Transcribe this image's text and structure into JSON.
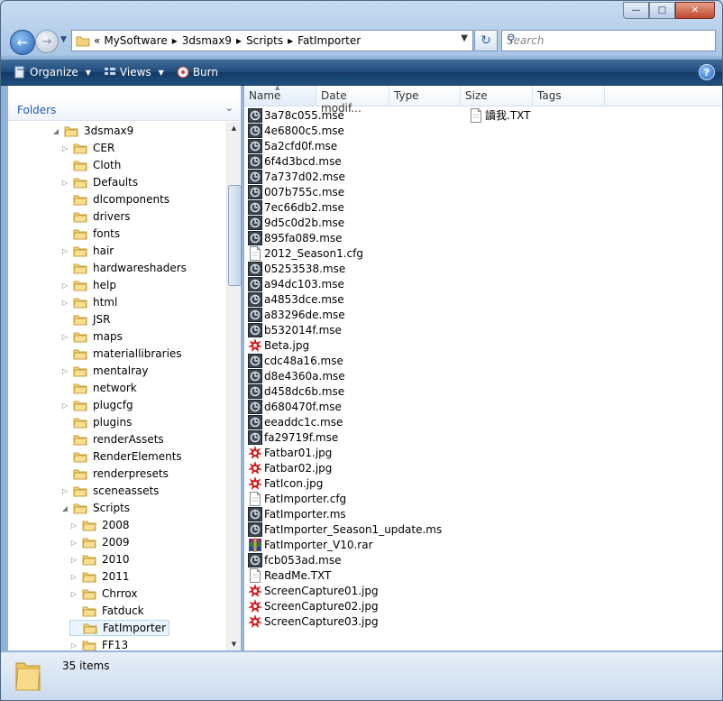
{
  "window": {
    "caption_buttons": [
      "minimize",
      "maximize",
      "close"
    ]
  },
  "nav": {
    "address_prefix": "«",
    "breadcrumb": [
      "MySoftware",
      "3dsmax9",
      "Scripts",
      "FatImporter"
    ],
    "search_placeholder": "Search"
  },
  "toolbar": {
    "organize": "Organize",
    "views": "Views",
    "burn": "Burn"
  },
  "left": {
    "header": "Folders",
    "tree": [
      {
        "label": "3dsmax9",
        "level": 0,
        "expander": "open"
      },
      {
        "label": "CER",
        "level": 1,
        "expander": "closed"
      },
      {
        "label": "Cloth",
        "level": 1,
        "expander": "none"
      },
      {
        "label": "Defaults",
        "level": 1,
        "expander": "closed"
      },
      {
        "label": "dlcomponents",
        "level": 1,
        "expander": "none"
      },
      {
        "label": "drivers",
        "level": 1,
        "expander": "none"
      },
      {
        "label": "fonts",
        "level": 1,
        "expander": "none"
      },
      {
        "label": "hair",
        "level": 1,
        "expander": "closed"
      },
      {
        "label": "hardwareshaders",
        "level": 1,
        "expander": "none"
      },
      {
        "label": "help",
        "level": 1,
        "expander": "closed"
      },
      {
        "label": "html",
        "level": 1,
        "expander": "closed"
      },
      {
        "label": "JSR",
        "level": 1,
        "expander": "none"
      },
      {
        "label": "maps",
        "level": 1,
        "expander": "closed"
      },
      {
        "label": "materiallibraries",
        "level": 1,
        "expander": "none"
      },
      {
        "label": "mentalray",
        "level": 1,
        "expander": "closed"
      },
      {
        "label": "network",
        "level": 1,
        "expander": "none"
      },
      {
        "label": "plugcfg",
        "level": 1,
        "expander": "closed"
      },
      {
        "label": "plugins",
        "level": 1,
        "expander": "none"
      },
      {
        "label": "renderAssets",
        "level": 1,
        "expander": "none"
      },
      {
        "label": "RenderElements",
        "level": 1,
        "expander": "none"
      },
      {
        "label": "renderpresets",
        "level": 1,
        "expander": "none"
      },
      {
        "label": "sceneassets",
        "level": 1,
        "expander": "closed"
      },
      {
        "label": "Scripts",
        "level": 1,
        "expander": "open"
      },
      {
        "label": "2008",
        "level": 2,
        "expander": "closed"
      },
      {
        "label": "2009",
        "level": 2,
        "expander": "closed"
      },
      {
        "label": "2010",
        "level": 2,
        "expander": "closed"
      },
      {
        "label": "2011",
        "level": 2,
        "expander": "closed"
      },
      {
        "label": "Chrrox",
        "level": 2,
        "expander": "closed"
      },
      {
        "label": "Fatduck",
        "level": 2,
        "expander": "none"
      },
      {
        "label": "FatImporter",
        "level": 2,
        "expander": "none",
        "selected": true
      },
      {
        "label": "FF13",
        "level": 2,
        "expander": "closed"
      }
    ]
  },
  "columns": [
    "Name",
    "Date modif...",
    "Type",
    "Size",
    "Tags"
  ],
  "files": [
    {
      "name": "3a78c055.mse",
      "icon": "script-icon"
    },
    {
      "name": "4e6800c5.mse",
      "icon": "script-icon"
    },
    {
      "name": "5a2cfd0f.mse",
      "icon": "script-icon"
    },
    {
      "name": "6f4d3bcd.mse",
      "icon": "script-icon"
    },
    {
      "name": "7a737d02.mse",
      "icon": "script-icon"
    },
    {
      "name": "007b755c.mse",
      "icon": "script-icon"
    },
    {
      "name": "7ec66db2.mse",
      "icon": "script-icon"
    },
    {
      "name": "9d5c0d2b.mse",
      "icon": "script-icon"
    },
    {
      "name": "895fa089.mse",
      "icon": "script-icon"
    },
    {
      "name": "2012_Season1.cfg",
      "icon": "text-file-icon"
    },
    {
      "name": "05253538.mse",
      "icon": "script-icon"
    },
    {
      "name": "a94dc103.mse",
      "icon": "script-icon"
    },
    {
      "name": "a4853dce.mse",
      "icon": "script-icon"
    },
    {
      "name": "a83296de.mse",
      "icon": "script-icon"
    },
    {
      "name": "b532014f.mse",
      "icon": "script-icon"
    },
    {
      "name": "Beta.jpg",
      "icon": "image-file-icon"
    },
    {
      "name": "cdc48a16.mse",
      "icon": "script-icon"
    },
    {
      "name": "d8e4360a.mse",
      "icon": "script-icon"
    },
    {
      "name": "d458dc6b.mse",
      "icon": "script-icon"
    },
    {
      "name": "d680470f.mse",
      "icon": "script-icon"
    },
    {
      "name": "eeaddc1c.mse",
      "icon": "script-icon"
    },
    {
      "name": "fa29719f.mse",
      "icon": "script-icon"
    },
    {
      "name": "Fatbar01.jpg",
      "icon": "image-file-icon"
    },
    {
      "name": "Fatbar02.jpg",
      "icon": "image-file-icon"
    },
    {
      "name": "FatIcon.jpg",
      "icon": "image-file-icon"
    },
    {
      "name": "FatImporter.cfg",
      "icon": "text-file-icon"
    },
    {
      "name": "FatImporter.ms",
      "icon": "script-icon"
    },
    {
      "name": "FatImporter_Season1_update.ms",
      "icon": "script-icon"
    },
    {
      "name": "FatImporter_V10.rar",
      "icon": "archive-file-icon"
    },
    {
      "name": "fcb053ad.mse",
      "icon": "script-icon"
    },
    {
      "name": "ReadMe.TXT",
      "icon": "text-file-icon"
    },
    {
      "name": "ScreenCapture01.jpg",
      "icon": "image-file-icon"
    },
    {
      "name": "ScreenCapture02.jpg",
      "icon": "image-file-icon"
    },
    {
      "name": "ScreenCapture03.jpg",
      "icon": "image-file-icon"
    },
    {
      "name": "讀我.TXT",
      "icon": "text-file-icon",
      "column": 2
    }
  ],
  "status": {
    "count": "35 items"
  }
}
